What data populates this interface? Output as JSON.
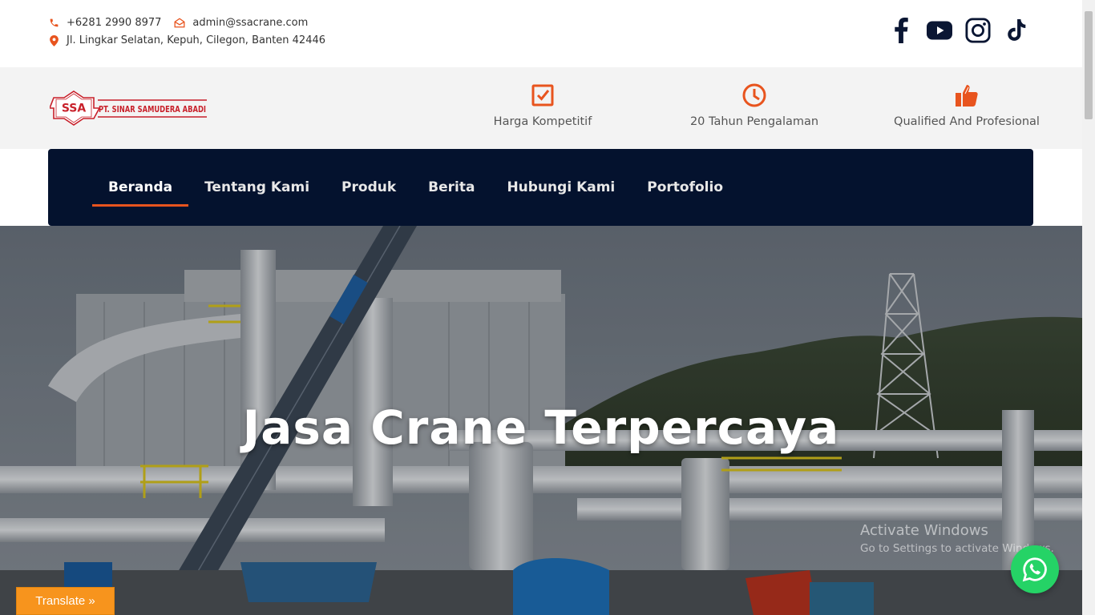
{
  "contact": {
    "phone": "+6281 2990 8977",
    "email": "admin@ssacrane.com",
    "address": "Jl. Lingkar Selatan, Kepuh, Cilegon, Banten 42446"
  },
  "socials": [
    "facebook-icon",
    "youtube-icon",
    "instagram-icon",
    "tiktok-icon"
  ],
  "brand": {
    "logo_mark": "SSA",
    "logo_text": "PT. SINAR SAMUDERA ABADI",
    "accent": "#e8541e",
    "logo_red": "#c8202a"
  },
  "features": [
    {
      "icon": "checkbox-icon",
      "label": "Harga Kompetitif"
    },
    {
      "icon": "clock-icon",
      "label": "20 Tahun Pengalaman"
    },
    {
      "icon": "thumbs-up-icon",
      "label": "Qualified And Profesional"
    }
  ],
  "nav": {
    "items": [
      {
        "label": "Beranda",
        "active": true
      },
      {
        "label": "Tentang Kami",
        "active": false
      },
      {
        "label": "Produk",
        "active": false
      },
      {
        "label": "Berita",
        "active": false
      },
      {
        "label": "Hubungi Kami",
        "active": false
      },
      {
        "label": "Portofolio",
        "active": false
      }
    ],
    "bg": "#04122e"
  },
  "hero": {
    "title": "Jasa Crane Terpercaya"
  },
  "watermark": {
    "line1": "Activate Windows",
    "line2": "Go to Settings to activate Windows."
  },
  "whatsapp": {
    "icon": "whatsapp-icon",
    "color": "#25d366"
  },
  "translate": {
    "label": "Translate »"
  }
}
